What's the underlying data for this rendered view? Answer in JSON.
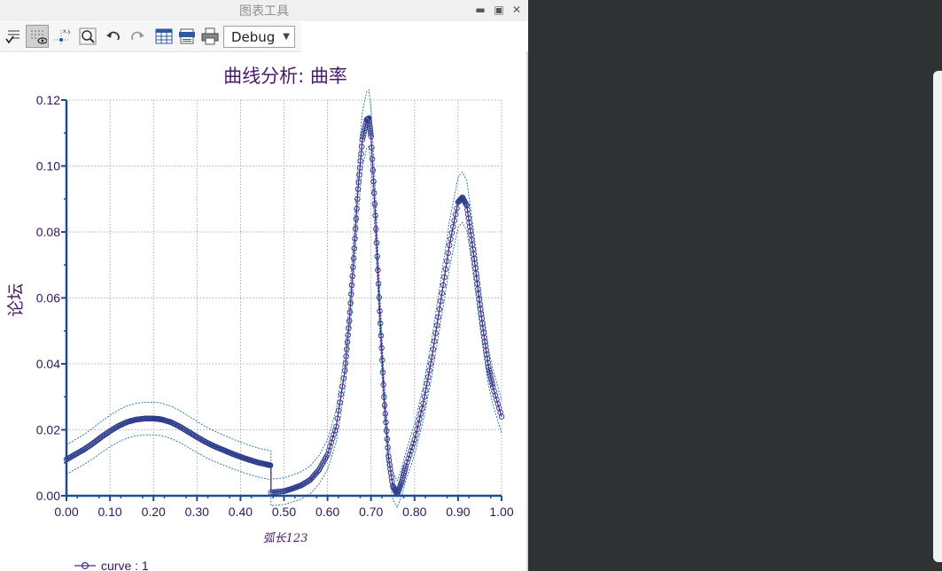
{
  "window": {
    "title": "图表工具"
  },
  "toolbar": {
    "buttons": [
      {
        "icon": "list-check-icon"
      },
      {
        "icon": "grid-eye-icon",
        "active": true
      },
      {
        "icon": "point-coords-icon"
      },
      {
        "icon": "zoom-icon"
      },
      {
        "icon": "undo-icon"
      },
      {
        "icon": "redo-icon"
      },
      {
        "icon": "table-icon"
      },
      {
        "icon": "txt-export-icon"
      },
      {
        "icon": "print-icon"
      }
    ],
    "debug_select": "Debug"
  },
  "colors": {
    "curve": "#5a1f86",
    "marker": "#2b3d8c",
    "envelope": "#1a6fa8",
    "axis": "#1d4e8f",
    "title": "#4a1a6a"
  },
  "chart_data": {
    "type": "line",
    "title": "曲线分析: 曲率",
    "xlabel": "弧长123",
    "ylabel": "论坛",
    "xlim": [
      0,
      1
    ],
    "ylim": [
      0,
      0.12
    ],
    "xticks": [
      "0.00",
      "0.10",
      "0.20",
      "0.30",
      "0.40",
      "0.50",
      "0.60",
      "0.70",
      "0.80",
      "0.90",
      "1.00"
    ],
    "yticks": [
      "0.00",
      "0.02",
      "0.04",
      "0.06",
      "0.08",
      "0.10",
      "0.12"
    ],
    "grid": true,
    "legend_position": "bottom-left",
    "series": [
      {
        "name": "curve : 1",
        "x": [
          0.0,
          0.02,
          0.04,
          0.06,
          0.08,
          0.1,
          0.12,
          0.14,
          0.16,
          0.18,
          0.2,
          0.21,
          0.22,
          0.24,
          0.26,
          0.28,
          0.3,
          0.32,
          0.34,
          0.36,
          0.38,
          0.4,
          0.42,
          0.44,
          0.46,
          0.47,
          0.47,
          0.5,
          0.52,
          0.54,
          0.56,
          0.58,
          0.6,
          0.62,
          0.64,
          0.65,
          0.66,
          0.67,
          0.68,
          0.69,
          0.695,
          0.7,
          0.71,
          0.72,
          0.73,
          0.74,
          0.75,
          0.76,
          0.77,
          0.78,
          0.8,
          0.82,
          0.84,
          0.86,
          0.88,
          0.9,
          0.91,
          0.92,
          0.93,
          0.94,
          0.95,
          0.96,
          0.97,
          0.98,
          1.0
        ],
        "y": [
          0.011,
          0.0125,
          0.014,
          0.0158,
          0.0178,
          0.0196,
          0.0212,
          0.0224,
          0.0231,
          0.0234,
          0.0234,
          0.0233,
          0.0231,
          0.0223,
          0.021,
          0.0194,
          0.0178,
          0.0163,
          0.015,
          0.0139,
          0.0128,
          0.0118,
          0.0109,
          0.0101,
          0.0095,
          0.0092,
          0.001,
          0.0014,
          0.0022,
          0.0032,
          0.0048,
          0.0078,
          0.0125,
          0.021,
          0.038,
          0.053,
          0.072,
          0.093,
          0.108,
          0.114,
          0.1145,
          0.109,
          0.085,
          0.056,
          0.03,
          0.012,
          0.003,
          0.0005,
          0.004,
          0.009,
          0.017,
          0.028,
          0.042,
          0.059,
          0.076,
          0.089,
          0.0905,
          0.088,
          0.079,
          0.069,
          0.058,
          0.048,
          0.039,
          0.033,
          0.024
        ]
      }
    ]
  }
}
